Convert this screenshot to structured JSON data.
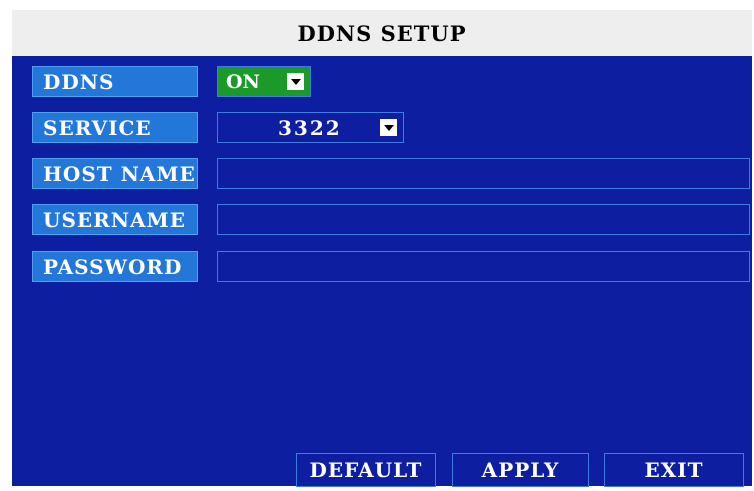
{
  "window": {
    "title": "DDNS SETUP"
  },
  "form": {
    "ddns": {
      "label": "DDNS",
      "value": "ON"
    },
    "service": {
      "label": "SERVICE",
      "value": "3322"
    },
    "host_name": {
      "label": "HOST NAME",
      "value": ""
    },
    "username": {
      "label": "USERNAME",
      "value": ""
    },
    "password": {
      "label": "PASSWORD",
      "value": ""
    }
  },
  "buttons": {
    "default": "DEFAULT",
    "apply": "APPLY",
    "exit": "EXIT"
  },
  "colors": {
    "panel": "#0d1fa0",
    "label_bg": "#2377d9",
    "on_green": "#1b9a2a",
    "border": "#3d7de0"
  },
  "icons": {
    "dropdown": "chevron-down-icon"
  }
}
